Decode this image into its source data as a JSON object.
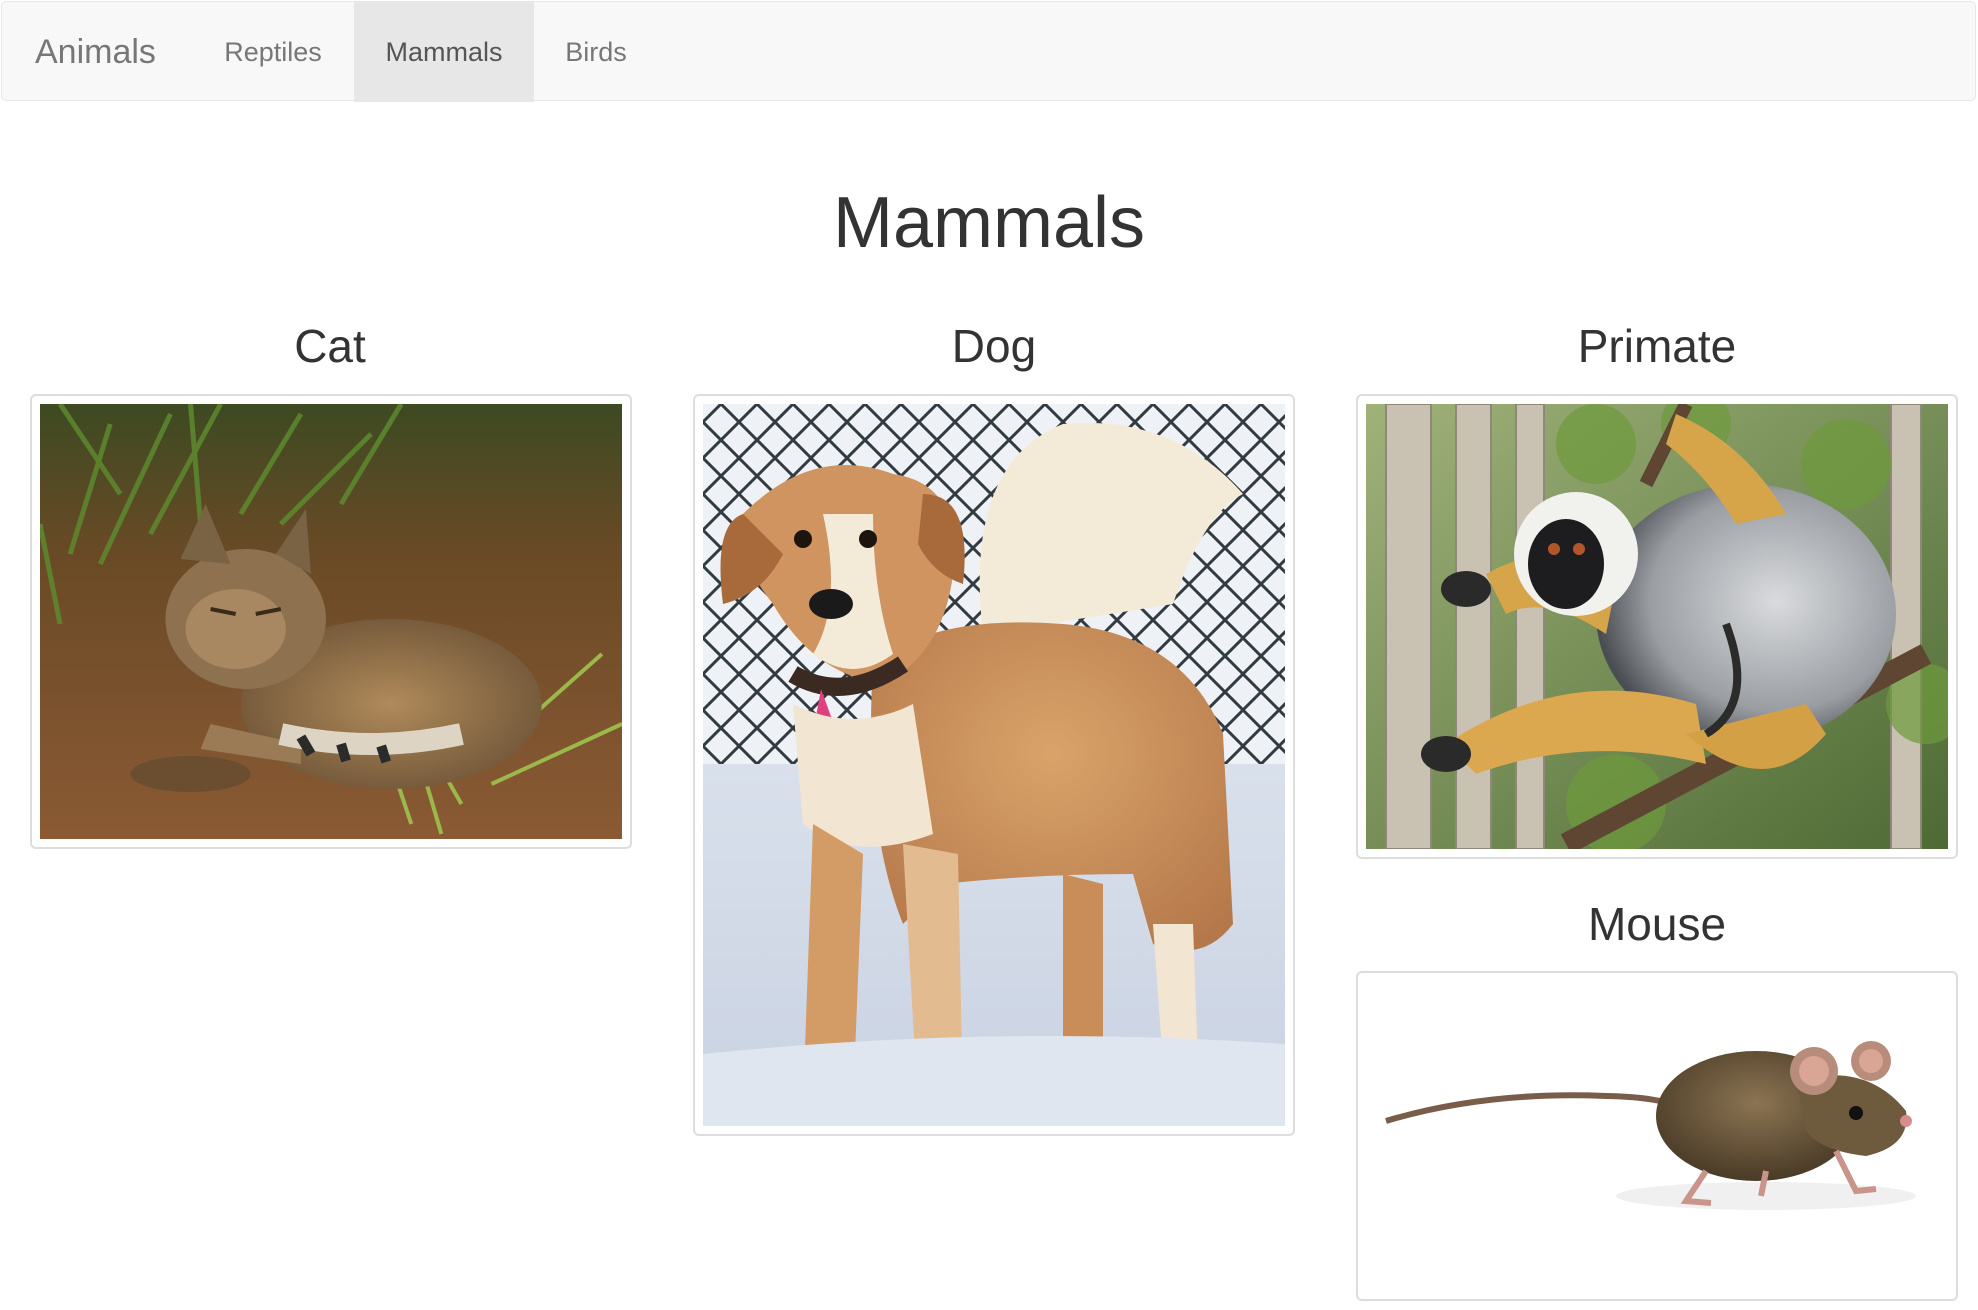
{
  "navbar": {
    "brand": "Animals",
    "items": [
      {
        "label": "Reptiles",
        "active": false
      },
      {
        "label": "Mammals",
        "active": true
      },
      {
        "label": "Birds",
        "active": false
      }
    ]
  },
  "main": {
    "title": "Mammals",
    "cards": [
      {
        "title": "Cat",
        "image": "cat-photo"
      },
      {
        "title": "Dog",
        "image": "dog-photo"
      },
      {
        "title": "Primate",
        "image": "primate-photo"
      },
      {
        "title": "Mouse",
        "image": "mouse-photo"
      }
    ]
  },
  "colors": {
    "navbar_bg": "#f8f8f8",
    "navbar_active_bg": "#e7e7e7",
    "nav_text": "#777777",
    "heading_text": "#333333",
    "thumbnail_border": "#dddddd"
  }
}
